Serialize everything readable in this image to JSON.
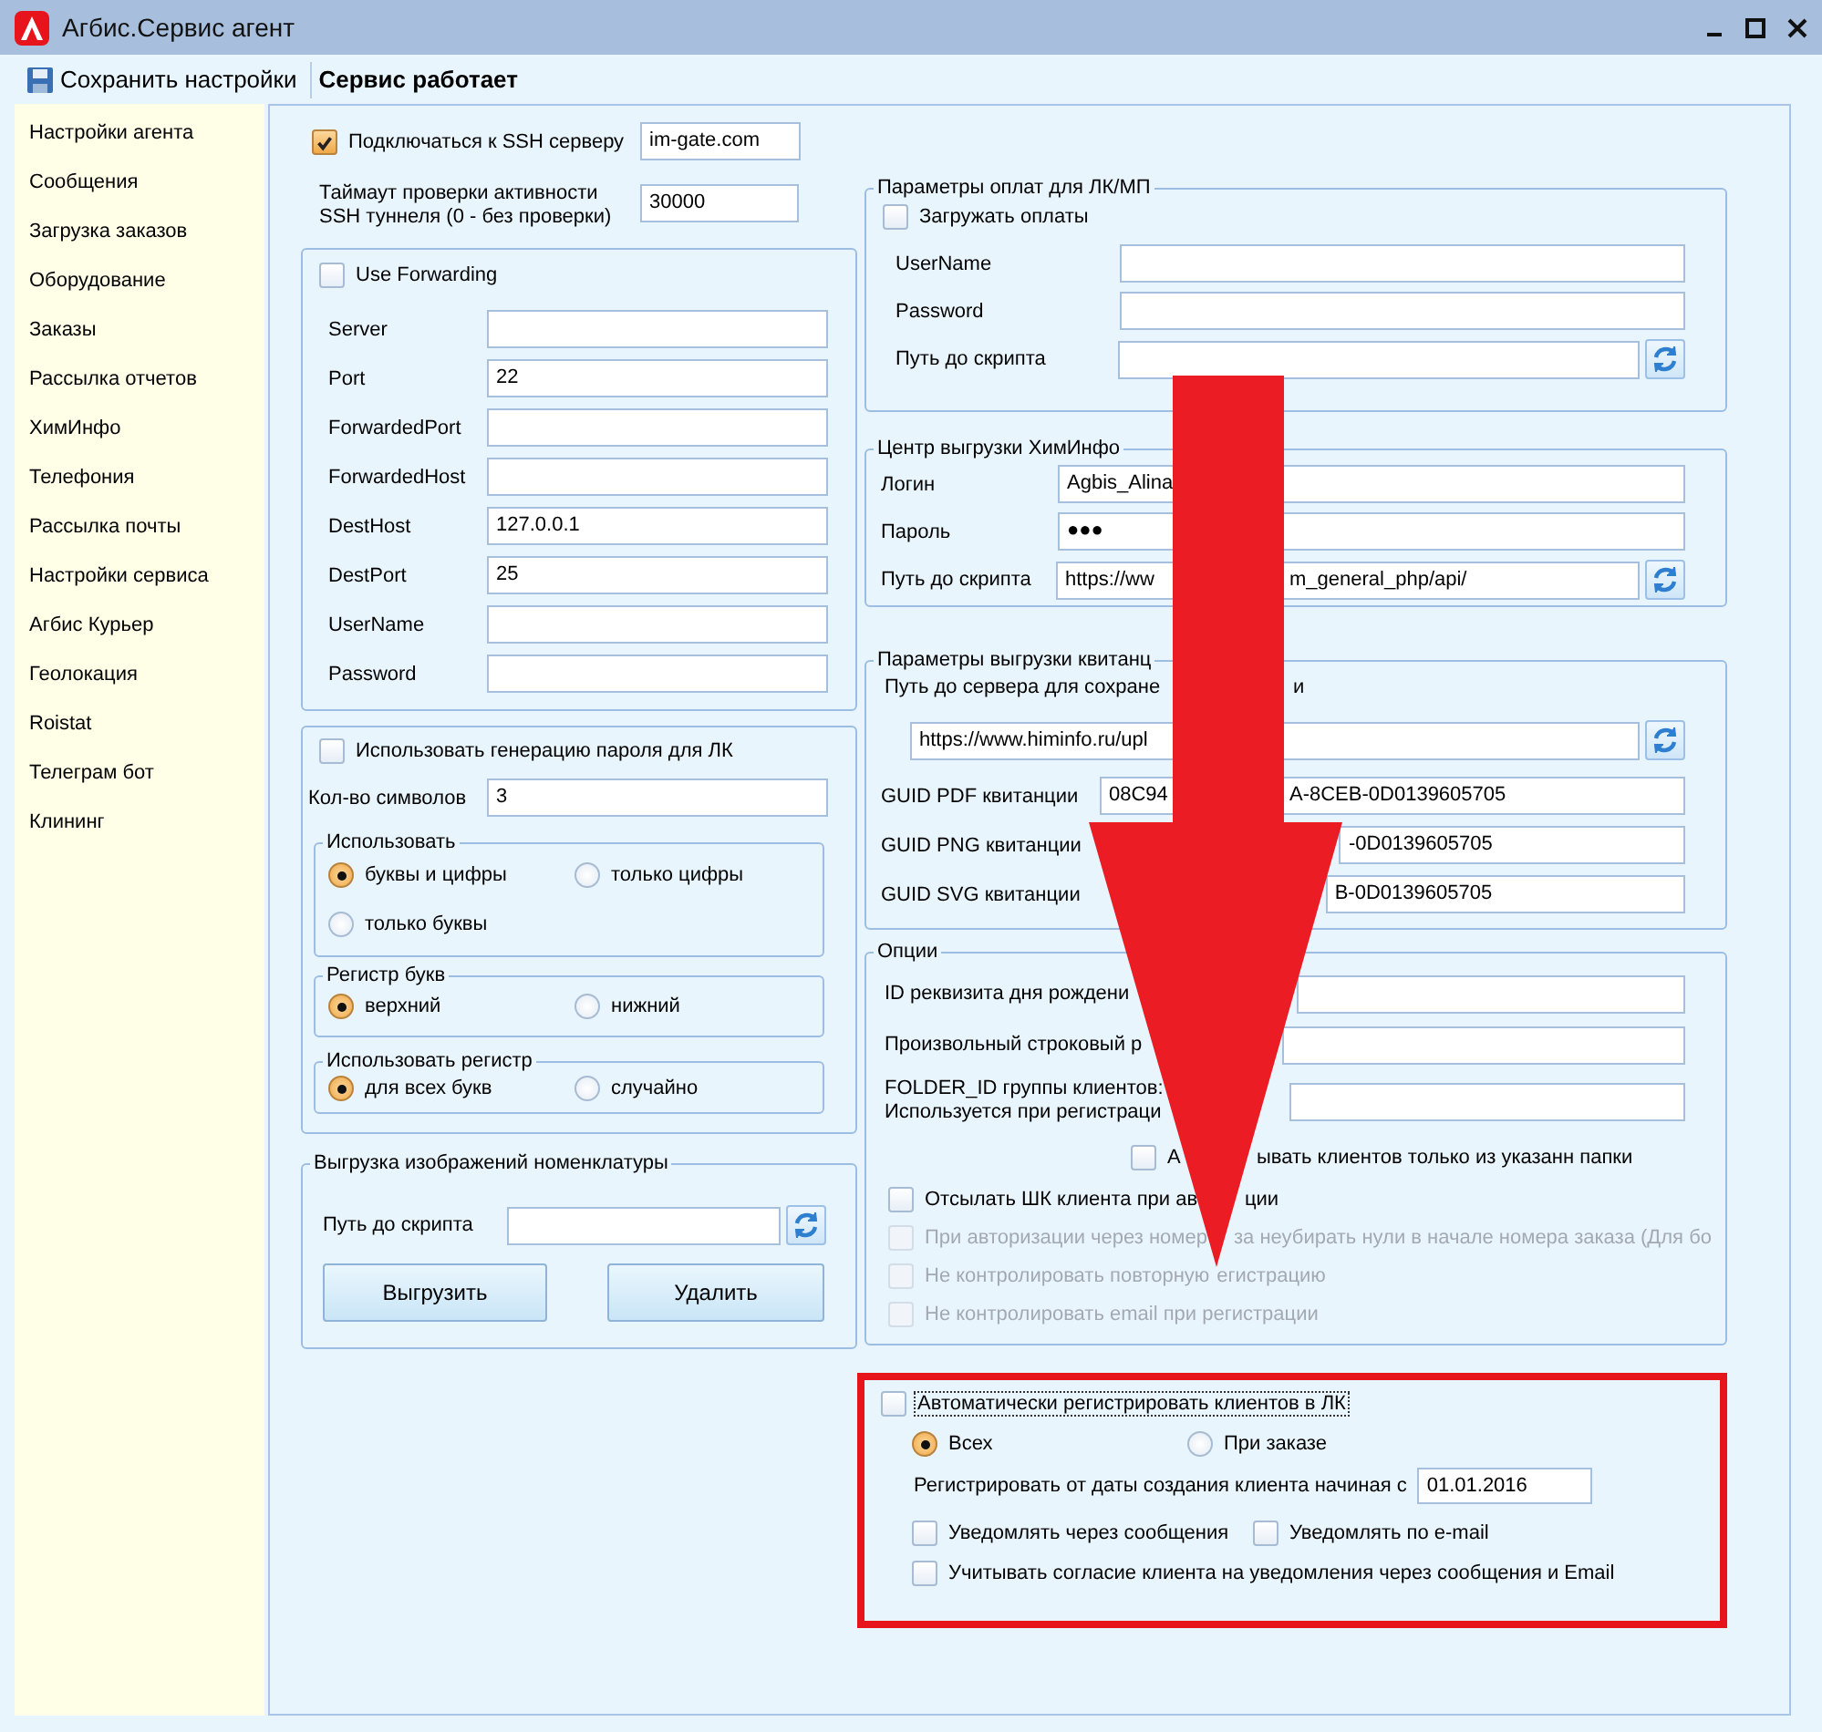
{
  "window": {
    "title": "Агбис.Сервис агент"
  },
  "toolbar": {
    "save_button": "Сохранить настройки",
    "status": "Сервис работает"
  },
  "sidebar": {
    "items": [
      "Настройки агента",
      "Сообщения",
      "Загрузка заказов",
      "Оборудование",
      "Заказы",
      "Рассылка отчетов",
      "ХимИнфо",
      "Телефония",
      "Рассылка почты",
      "Настройки сервиса",
      "Агбис Курьер",
      "Геолокация",
      "Roistat",
      "Телеграм бот",
      "Клининг"
    ]
  },
  "ssh": {
    "connect": {
      "label": "Подключаться к SSH серверу",
      "checked": true,
      "value": "im-gate.com"
    },
    "timeout": {
      "lines": [
        "Таймаут проверки активности",
        "SSH туннеля (0 - без проверки)"
      ],
      "value": "30000"
    },
    "forwarding": {
      "label": "Use Forwarding",
      "checked": false,
      "fields": [
        {
          "label": "Server"
        },
        {
          "label": "Port",
          "value": "22"
        },
        {
          "label": "ForwardedPort"
        },
        {
          "label": "ForwardedHost"
        },
        {
          "label": "DestHost",
          "value": "127.0.0.1"
        },
        {
          "label": "DestPort",
          "value": "25"
        },
        {
          "label": "UserName"
        },
        {
          "label": "Password"
        }
      ]
    }
  },
  "password_generation": {
    "label": "Использовать генерацию пароля для ЛК",
    "checked": false,
    "length": {
      "label": "Кол-во символов",
      "value": "3"
    },
    "groups": [
      {
        "legend": "Использовать",
        "options": [
          {
            "label": "буквы и цифры",
            "selected": true
          },
          {
            "label": "только цифры",
            "selected": false
          },
          {
            "label": "только буквы",
            "selected": false
          }
        ]
      },
      {
        "legend": "Регистр букв",
        "options": [
          {
            "label": "верхний",
            "selected": true
          },
          {
            "label": "нижний",
            "selected": false
          }
        ]
      },
      {
        "legend": "Использовать регистр",
        "options": [
          {
            "label": "для всех букв",
            "selected": true
          },
          {
            "label": "случайно",
            "selected": false
          }
        ]
      }
    ]
  },
  "image_export": {
    "legend": "Выгрузка изображений номенклатуры",
    "path_label": "Путь до скрипта",
    "buttons": [
      "Выгрузить",
      "Удалить"
    ]
  },
  "payments": {
    "legend": "Параметры оплат для ЛК/МП",
    "load": {
      "label": "Загружать оплаты",
      "checked": false
    },
    "fields": [
      {
        "label": "UserName",
        "kind": "text"
      },
      {
        "label": "Password",
        "kind": "text"
      },
      {
        "label": "Путь до скрипта",
        "kind": "path"
      }
    ]
  },
  "himinfo": {
    "legend": "Центр выгрузки ХимИнфо",
    "fields": [
      {
        "label": "Логин",
        "value": "Agbis_Alina",
        "kind": "text"
      },
      {
        "label": "Пароль",
        "value": "●●●",
        "kind": "password"
      },
      {
        "label": "Путь до скрипта",
        "value": "https://ww",
        "value_after": "m_general_php/api/",
        "kind": "path"
      }
    ]
  },
  "receipts": {
    "legend": "Параметры выгрузки квитанц",
    "server_label": "Путь до сервера для сохране",
    "server_label_after": "и",
    "server_value": "https://www.himinfo.ru/upl",
    "guids": [
      {
        "label": "GUID PDF квитанции",
        "value": "08C94",
        "value_after": "A-8CEB-0D0139605705"
      },
      {
        "label": "GUID PNG квитанции",
        "value_after": "-0D0139605705"
      },
      {
        "label": "GUID SVG квитанции",
        "value_after": "B-0D0139605705"
      }
    ]
  },
  "options": {
    "legend": "Опции",
    "fields": [
      {
        "lines": [
          "ID реквизита дня рождени"
        ]
      },
      {
        "lines": [
          "Произвольный строковый р"
        ]
      },
      {
        "lines": [
          "FOLDER_ID группы клиентов:",
          "Используется при регистраци"
        ]
      }
    ],
    "checks": [
      {
        "label": "А",
        "label_after": "ывать клиентов только из указанн папки",
        "checked": false,
        "disabled": false,
        "kind": "nested"
      },
      {
        "label": "Отсылать ШК клиента при ав",
        "label_after": "ции",
        "checked": false,
        "disabled": false,
        "kind": "plain"
      },
      {
        "label": "При авторизации через номер",
        "label_after": "за неубирать нули в начале номера заказа (Для бо",
        "checked": false,
        "disabled": true,
        "kind": "plain"
      },
      {
        "label": "Не контролировать повторную",
        "label_after": "егистрацию",
        "checked": false,
        "disabled": true,
        "kind": "plain"
      },
      {
        "label": "Не контролировать email при регистрации",
        "checked": false,
        "disabled": true,
        "kind": "plain"
      }
    ]
  },
  "auto_register": {
    "label": "Автоматически регистрировать клиентов в ЛК",
    "checked": false,
    "focused": true,
    "modes": [
      {
        "label": "Всех",
        "selected": true
      },
      {
        "label": "При заказе",
        "selected": false
      }
    ],
    "date": {
      "label": "Регистрировать от даты создания клиента начиная с",
      "value": "01.01.2016"
    },
    "notify": [
      {
        "label": "Уведомлять через сообщения",
        "checked": false
      },
      {
        "label": "Уведомлять по e-mail",
        "checked": false
      },
      {
        "label": "Учитывать согласие клиента на уведомления через сообщения и Email",
        "checked": false
      }
    ]
  }
}
